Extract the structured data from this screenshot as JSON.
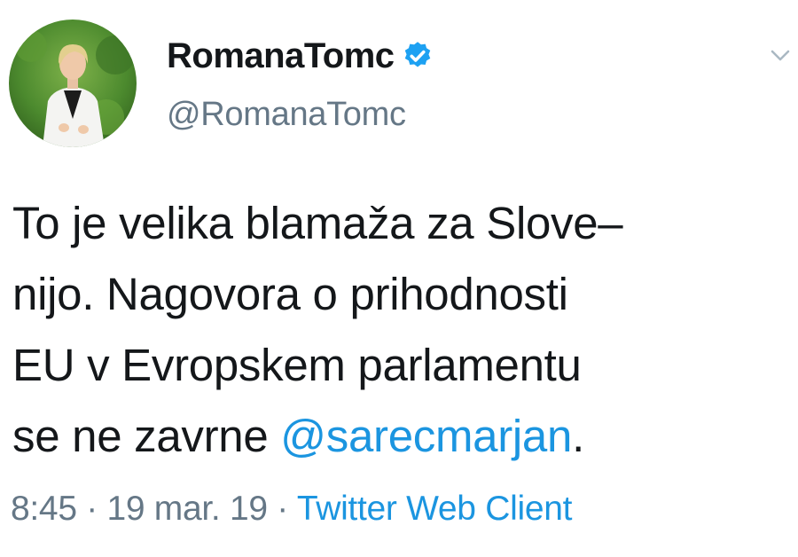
{
  "author": {
    "display_name": "RomanaTomc",
    "handle": "@RomanaTomc",
    "verified": true
  },
  "tweet": {
    "lines": [
      "To je velika blamaža za Slove–",
      "nijo. Nagovora o prihodnosti",
      "EU v Evropskem parlamentu"
    ],
    "last_line_prefix": "se ne zavrne ",
    "mention": "@sarecmarjan",
    "last_line_suffix": "."
  },
  "meta": {
    "time": "8:45",
    "separator1": " · ",
    "date": "19 mar. 19",
    "separator2": " · ",
    "source": "Twitter Web Client"
  },
  "icons": {
    "verified": "verified-badge-icon",
    "menu": "chevron-down-icon"
  },
  "colors": {
    "text": "#14171a",
    "secondary": "#657786",
    "link": "#1b95e0",
    "verified": "#1da1f2"
  }
}
